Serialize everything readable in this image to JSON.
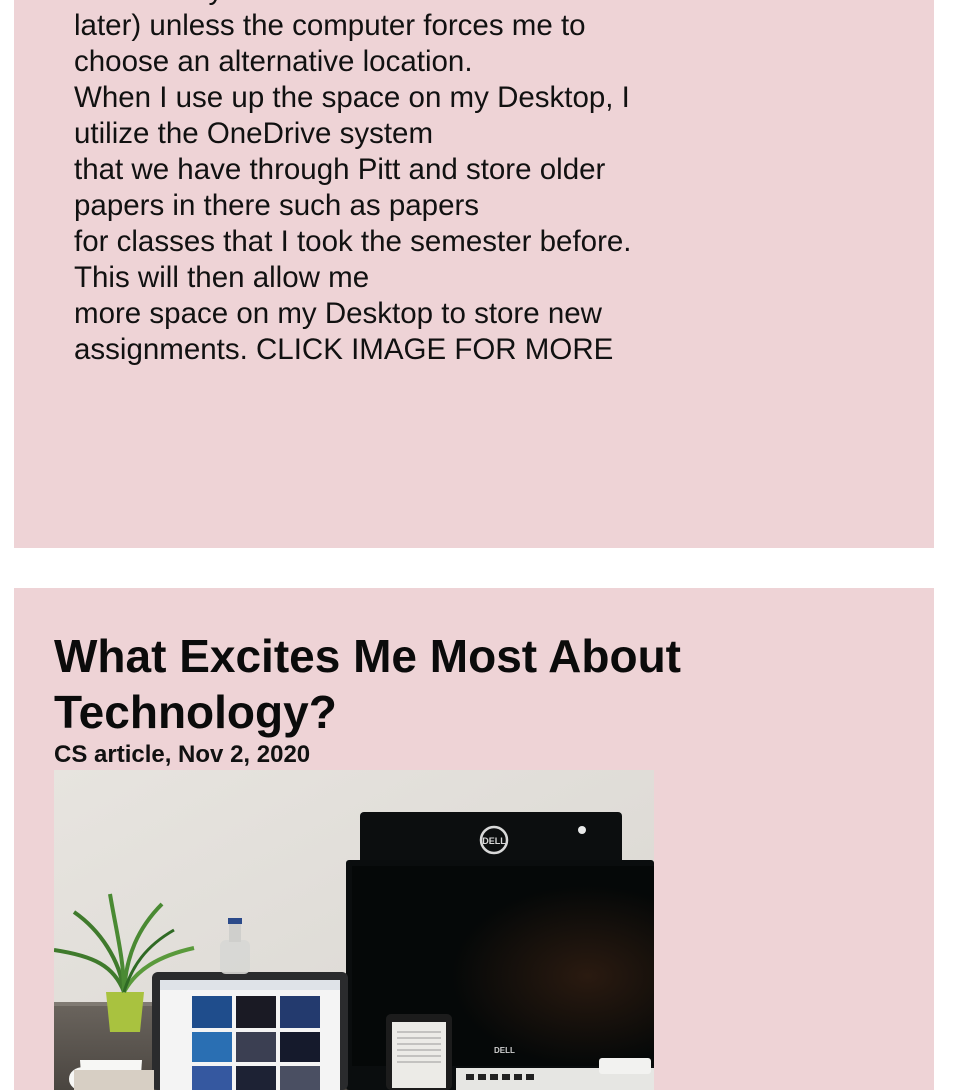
{
  "post_top": {
    "cut_line": "that is easy to find",
    "lines": [
      "later) unless the computer forces me to",
      "choose an alternative location.",
      "When I use up the space on my Desktop, I",
      "utilize the OneDrive system",
      "that we have through Pitt and store older",
      "papers in there such as papers",
      "for classes that I took the semester before.",
      "This will then allow me",
      "more space on my Desktop to store new",
      "assignments. CLICK IMAGE FOR MORE"
    ]
  },
  "post_bottom": {
    "title_lines": [
      "What Excites Me Most About",
      "Technology?"
    ],
    "meta": "CS article, Nov 2, 2020",
    "image": {
      "monitor_brand": "DELL",
      "keyboard_brand": "DELL"
    }
  },
  "colors": {
    "card_background": "#eed3d6",
    "page_background": "#ffffff",
    "text": "#111111"
  }
}
